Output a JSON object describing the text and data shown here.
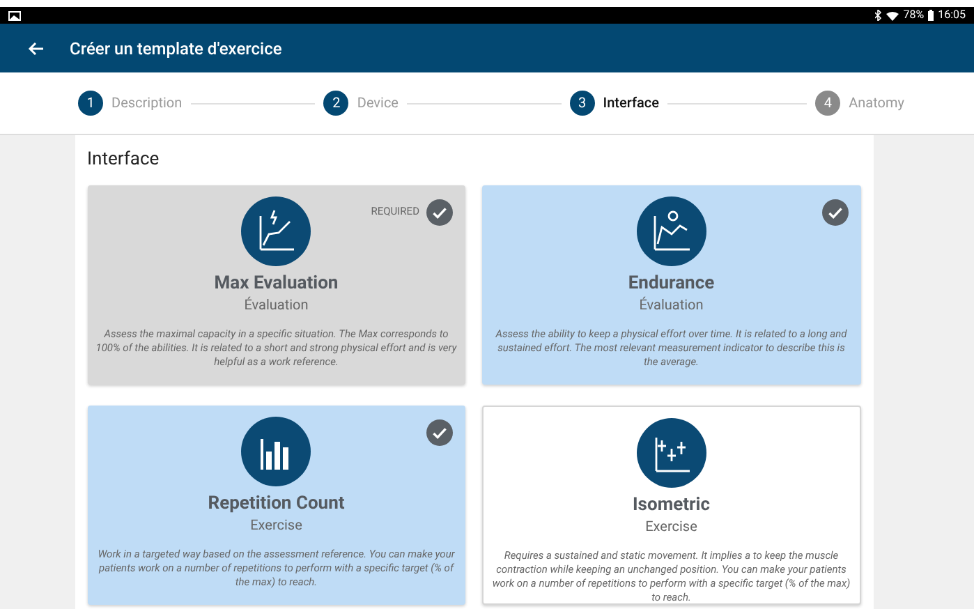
{
  "status_bar": {
    "battery": "78%",
    "time": "16:05"
  },
  "app_bar": {
    "title": "Créer un template d'exercice"
  },
  "steps": [
    {
      "number": "1",
      "label": "Description",
      "reached": true,
      "selected": false
    },
    {
      "number": "2",
      "label": "Device",
      "reached": true,
      "selected": false
    },
    {
      "number": "3",
      "label": "Interface",
      "reached": true,
      "selected": true
    },
    {
      "number": "4",
      "label": "Anatomy",
      "reached": false,
      "selected": false
    }
  ],
  "section_title": "Interface",
  "cards": [
    {
      "kind": "max",
      "title": "Max Evaluation",
      "subtitle": "Évaluation",
      "description": "Assess the maximal capacity in a specific situation. The Max corresponds to 100% of the abilities. It is related to a short and strong physical effort and is very helpful as a work reference.",
      "required": true,
      "required_label": "REQUIRED",
      "selected": true
    },
    {
      "kind": "endurance",
      "title": "Endurance",
      "subtitle": "Évaluation",
      "description": "Assess the ability to keep a physical effort over time. It is related to a long and sustained effort. The most relevant measurement indicator to describe this is the average.",
      "required": false,
      "selected": true
    },
    {
      "kind": "bars",
      "title": "Repetition Count",
      "subtitle": "Exercise",
      "description": "Work in a targeted way based on the assessment reference. You can make your patients work on a number of repetitions to perform with a specific target (% of the max) to reach.",
      "required": false,
      "selected": true
    },
    {
      "kind": "isometric",
      "title": "Isometric",
      "subtitle": "Exercise",
      "description": "Requires a sustained and static movement. It implies a to keep the muscle contraction while keeping an unchanged position. You can make your patients work on a number of repetitions to perform with a specific target (% of the max) to reach.",
      "required": false,
      "selected": false
    }
  ]
}
